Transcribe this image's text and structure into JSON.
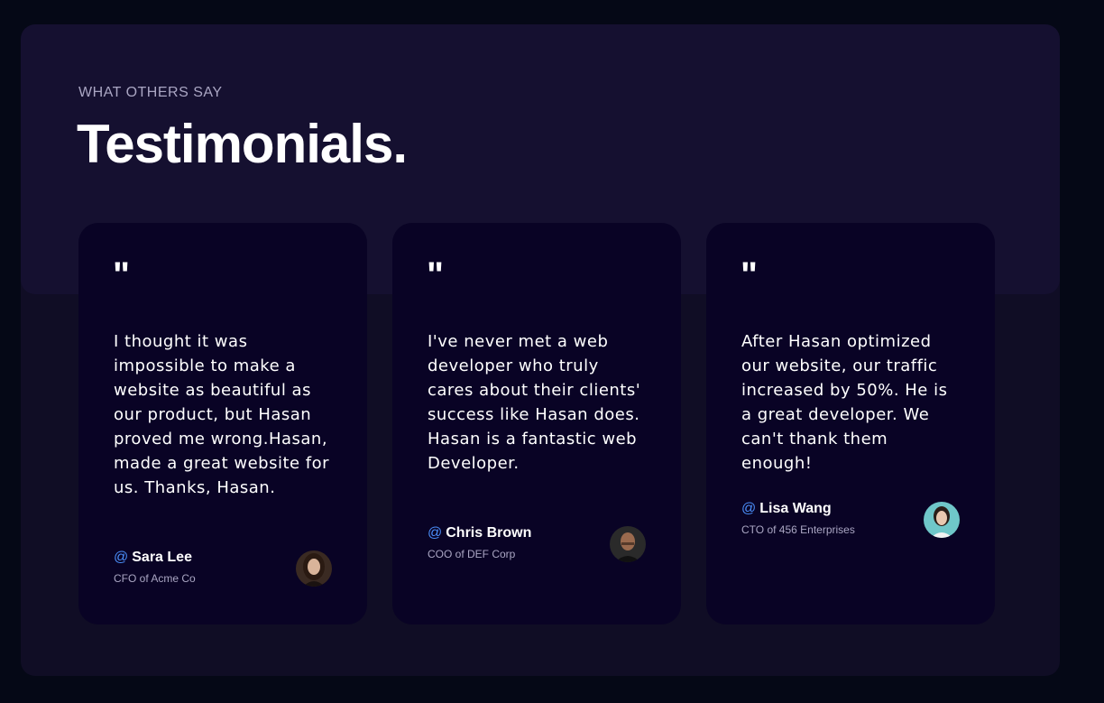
{
  "header": {
    "subtitle": "WHAT OTHERS SAY",
    "title": "Testimonials."
  },
  "testimonials": [
    {
      "quote_mark": "\"",
      "text": "I thought it was impossible to make a website as beautiful as our product, but Hasan proved me wrong.Hasan, made a great website for us. Thanks, Hasan.",
      "at": "@",
      "name": "Sara Lee",
      "role": "CFO of Acme Co",
      "avatar": "person-photo"
    },
    {
      "quote_mark": "\"",
      "text": "I've never met a web developer who truly cares about their clients' success like Hasan does. Hasan is a fantastic web Developer.",
      "at": "@",
      "name": "Chris Brown",
      "role": "COO of DEF Corp",
      "avatar": "person-photo"
    },
    {
      "quote_mark": "\"",
      "text": "After Hasan optimized our website, our traffic increased by 50%. He is a great developer. We can't thank them enough!",
      "at": "@",
      "name": "Lisa Wang",
      "role": "CTO of 456 Enterprises",
      "avatar": "person-photo"
    }
  ],
  "colors": {
    "page_bg": "#050816",
    "section_bg": "#100d25",
    "section_top_bg": "#151030",
    "card_bg": "#090325",
    "accent": "#4a8df8",
    "secondary_text": "#aaa6c3"
  }
}
